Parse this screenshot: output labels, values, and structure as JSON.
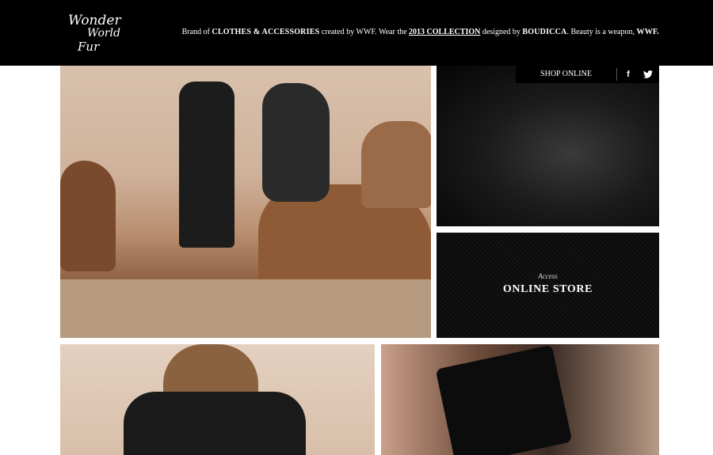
{
  "header": {
    "logo_lines": [
      "Wonder",
      "World",
      "Fur"
    ],
    "tagline_parts": [
      "Brand of ",
      "CLOTHES & ACCESSORIES",
      " created by WWF. Wear the ",
      "2013 COLLECTION",
      " designed by ",
      "BOUDICCA",
      ". Beauty is a weapon, ",
      "WWF."
    ]
  },
  "shopbar": {
    "shop_label": "SHOP ONLINE",
    "facebook_glyph": "f",
    "twitter_glyph": "🐦"
  },
  "store_tile": {
    "small_label": "Access",
    "big_label": "ONLINE STORE"
  },
  "icons": [
    "facebook-icon",
    "twitter-icon"
  ]
}
